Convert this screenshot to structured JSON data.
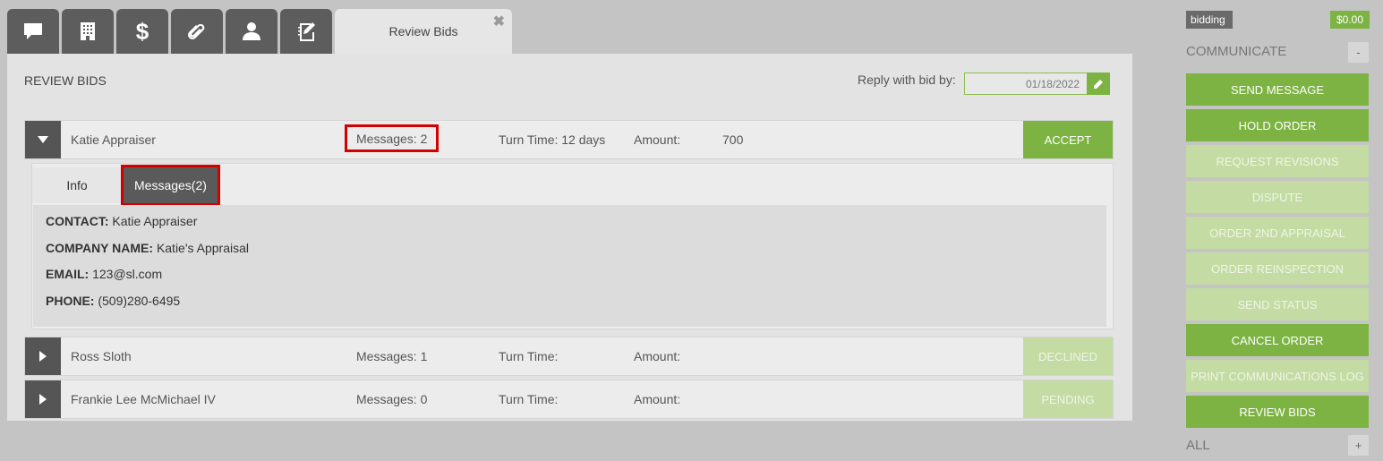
{
  "tabs": {
    "icons": [
      "chat-icon",
      "building-icon",
      "dollar-icon",
      "paperclip-icon",
      "user-icon",
      "notepad-icon"
    ],
    "active_label": "Review Bids",
    "close_symbol": "✖"
  },
  "panel": {
    "title": "REVIEW BIDS",
    "reply_label": "Reply with bid by:",
    "reply_date": "01/18/2022"
  },
  "bids": [
    {
      "name": "Katie Appraiser",
      "messages": "Messages: 2",
      "turn_time": "Turn Time: 12 days",
      "amount_label": "Amount:",
      "amount": "700",
      "status": "ACCEPT",
      "expanded": true
    },
    {
      "name": "Ross Sloth",
      "messages": "Messages: 1",
      "turn_time": "Turn Time:",
      "amount_label": "Amount:",
      "amount": "",
      "status": "DECLINED",
      "expanded": false
    },
    {
      "name": "Frankie Lee McMichael IV",
      "messages": "Messages: 0",
      "turn_time": "Turn Time:",
      "amount_label": "Amount:",
      "amount": "",
      "status": "PENDING",
      "expanded": false
    }
  ],
  "detail": {
    "tab_info": "Info",
    "tab_messages": "Messages(2)",
    "contact_label": "CONTACT:",
    "contact": "Katie Appraiser",
    "company_label": "COMPANY NAME:",
    "company": "Katie's Appraisal",
    "email_label": "EMAIL:",
    "email": "123@sl.com",
    "phone_label": "PHONE:",
    "phone": "(509)280-6495"
  },
  "sidebar": {
    "status_badge": "bidding",
    "amount_badge": "$0.00",
    "communicate_label": "COMMUNICATE",
    "communicate_toggle": "-",
    "buttons": [
      {
        "label": "SEND MESSAGE",
        "enabled": true
      },
      {
        "label": "HOLD ORDER",
        "enabled": true
      },
      {
        "label": "REQUEST REVISIONS",
        "enabled": false
      },
      {
        "label": "DISPUTE",
        "enabled": false
      },
      {
        "label": "ORDER 2ND APPRAISAL",
        "enabled": false
      },
      {
        "label": "ORDER REINSPECTION",
        "enabled": false
      },
      {
        "label": "SEND STATUS",
        "enabled": false
      },
      {
        "label": "CANCEL ORDER",
        "enabled": true
      },
      {
        "label": "PRINT COMMUNICATIONS LOG",
        "enabled": false
      },
      {
        "label": "REVIEW BIDS",
        "enabled": true
      }
    ],
    "all_label": "ALL",
    "all_toggle": "+"
  },
  "colors": {
    "accent_green": "#7cb342",
    "disabled_green": "#c4dba4",
    "dark_tab": "#5d5d5d",
    "highlight_red": "#d40000"
  }
}
